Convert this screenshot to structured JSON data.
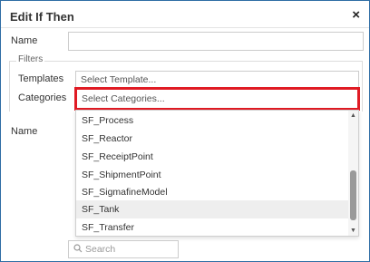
{
  "dialog": {
    "title": "Edit If Then",
    "close_symbol": "×"
  },
  "form": {
    "name_label": "Name",
    "name_value": "",
    "filters_legend": "Filters",
    "templates_label": "Templates",
    "templates_placeholder": "Select Template...",
    "categories_label": "Categories",
    "categories_placeholder": "Select Categories...",
    "name2_label": "Name"
  },
  "dropdown": {
    "options": [
      {
        "label": "SF_Process",
        "selected": false
      },
      {
        "label": "SF_Reactor",
        "selected": false
      },
      {
        "label": "SF_ReceiptPoint",
        "selected": false
      },
      {
        "label": "SF_ShipmentPoint",
        "selected": false
      },
      {
        "label": "SF_SigmafineModel",
        "selected": false
      },
      {
        "label": "SF_Tank",
        "selected": true
      },
      {
        "label": "SF_Transfer",
        "selected": false
      }
    ],
    "scroll_up_symbol": "▲",
    "scroll_down_symbol": "▼"
  },
  "search": {
    "placeholder": "Search",
    "icon": "search-icon"
  },
  "colors": {
    "frame_border": "#2e6da4",
    "highlight": "#e01b24",
    "selected_row": "#eeeeee"
  }
}
